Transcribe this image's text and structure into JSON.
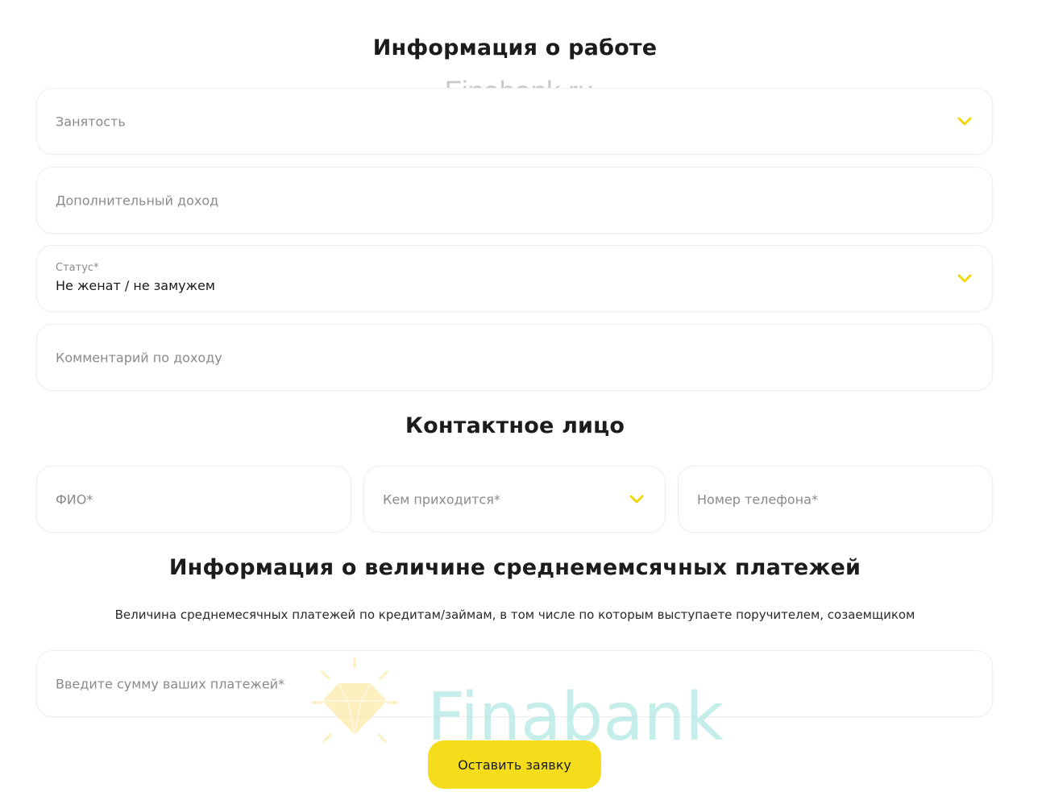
{
  "watermark": {
    "top_text": "Finabank.ru",
    "logo_text": "Finabank"
  },
  "work_section": {
    "title": "Информация о работе",
    "employment": {
      "placeholder": "Занятость"
    },
    "additional_income": {
      "placeholder": "Дополнительный доход"
    },
    "status": {
      "label": "Статус*",
      "value": "Не женат / не замужем"
    },
    "income_comment": {
      "placeholder": "Комментарий по доходу"
    }
  },
  "contact_section": {
    "title": "Контактное лицо",
    "full_name": {
      "placeholder": "ФИО*"
    },
    "relation": {
      "placeholder": "Кем приходится*"
    },
    "phone": {
      "placeholder": "Номер телефона*"
    }
  },
  "payments_section": {
    "title": "Информация о величине среднемемсячных платежей",
    "description": "Величина среднемесячных платежей по кредитам/займам, в том числе по которым выступаете поручителем, созаемщиком",
    "amount": {
      "placeholder": "Введите сумму ваших платежей*"
    }
  },
  "submit_label": "Оставить заявку",
  "colors": {
    "accent": "#f5dd1c",
    "chevron": "#f2d600",
    "logo_text": "#9fe3dd",
    "logo_gem": "#fde28a"
  },
  "icons": {
    "dropdown": "chevron-down-icon",
    "logo": "diamond-icon"
  }
}
